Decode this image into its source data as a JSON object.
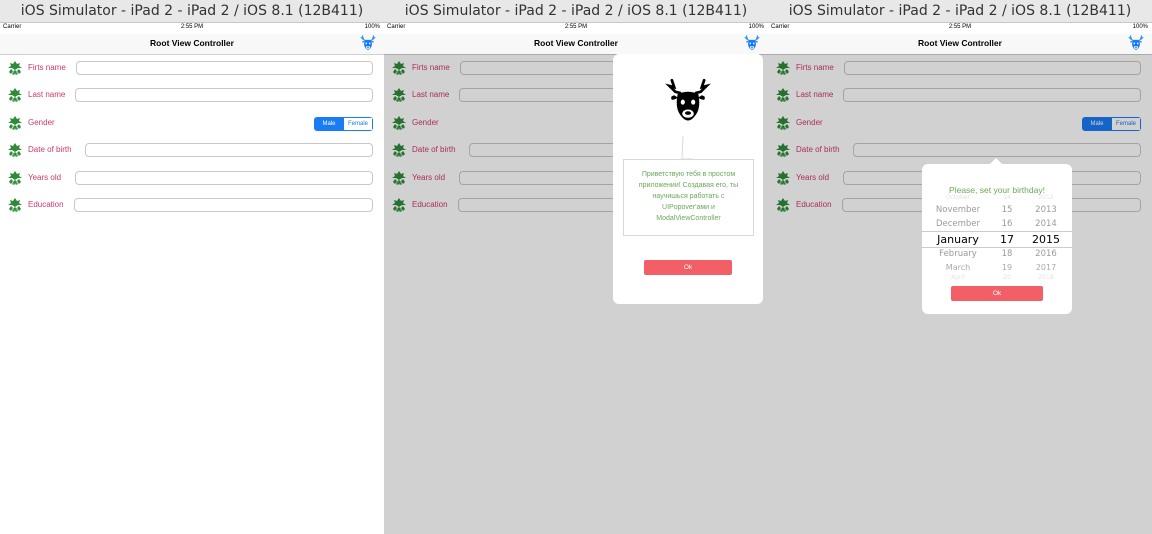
{
  "window_title": "iOS Simulator - iPad 2 - iPad 2 / iOS 8.1 (12B411)",
  "status": {
    "carrier": "Carrier",
    "time": "2:55 PM",
    "battery": "100%"
  },
  "nav": {
    "title": "Root View Controller",
    "right_icon": "deer-icon"
  },
  "form": {
    "rows": [
      {
        "label": "Firts name",
        "value": ""
      },
      {
        "label": "Last name",
        "value": ""
      },
      {
        "label": "Gender"
      },
      {
        "label": "Date of birth",
        "value": ""
      },
      {
        "label": "Years old",
        "value": ""
      },
      {
        "label": "Education",
        "value": ""
      }
    ],
    "gender": {
      "options": [
        "Male",
        "Female"
      ],
      "selected": "Male"
    },
    "row_icon": "holly-icon"
  },
  "welcome_popover": {
    "icon": "deer-head-icon",
    "message": "Приветствую тебя в простом приложении! Создавая его, ты научишься работать с UIPopover'ами и ModalViewController",
    "ok_label": "Ok"
  },
  "birthday_popover": {
    "title": "Please, set your birthday!",
    "months": [
      "October",
      "November",
      "December",
      "January",
      "February",
      "March",
      "April"
    ],
    "days": [
      "14",
      "15",
      "16",
      "17",
      "18",
      "19",
      "20"
    ],
    "years": [
      "2012",
      "2013",
      "2014",
      "2015",
      "2016",
      "2017",
      "2018"
    ],
    "selected": {
      "month": "January",
      "day": "17",
      "year": "2015"
    },
    "ok_label": "Ok"
  },
  "colors": {
    "label": "#cc3a6a",
    "accent": "#1a7cf5",
    "ok_button": "#f25f66",
    "popover_text": "#6aa85a",
    "holly_green": "#2f8a3a"
  }
}
